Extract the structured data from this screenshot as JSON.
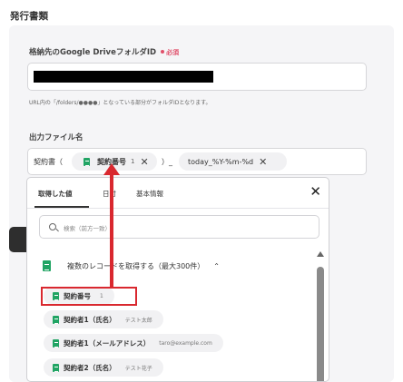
{
  "section": {
    "title": "発行書類"
  },
  "folder": {
    "label": "格納先のGoogle DriveフォルダID",
    "required": "必須",
    "hint": "URL内の「/folders/●●●●」となっている部分がフォルダIDとなります。"
  },
  "filename": {
    "label": "出力ファイル名",
    "prefix": "契約書（",
    "chip1": {
      "label": "契約番号",
      "value": "1"
    },
    "separator": "）_",
    "chip2": {
      "label": "today_%Y-%m-%d"
    }
  },
  "popup": {
    "tabs": [
      "取得した値",
      "日付",
      "基本情報"
    ],
    "search_placeholder": "検索（前方一致）",
    "group_label": "複数のレコードを取得する（最大300件）",
    "items": [
      {
        "name": "契約番号",
        "value": "1"
      },
      {
        "name": "契約者1（氏名）",
        "value": "テスト太郎"
      },
      {
        "name": "契約者1（メールアドレス）",
        "value": "taro@example.com"
      },
      {
        "name": "契約者2（氏名）",
        "value": "テスト花子"
      }
    ]
  },
  "icons": {
    "close": "close-icon",
    "search": "search-icon",
    "sheet": "google-sheets-icon",
    "chevron": "chevron-up-icon"
  },
  "colors": {
    "accent_red": "#d9282f",
    "sheets_green": "#21a464",
    "required_pink": "#e0506b"
  }
}
